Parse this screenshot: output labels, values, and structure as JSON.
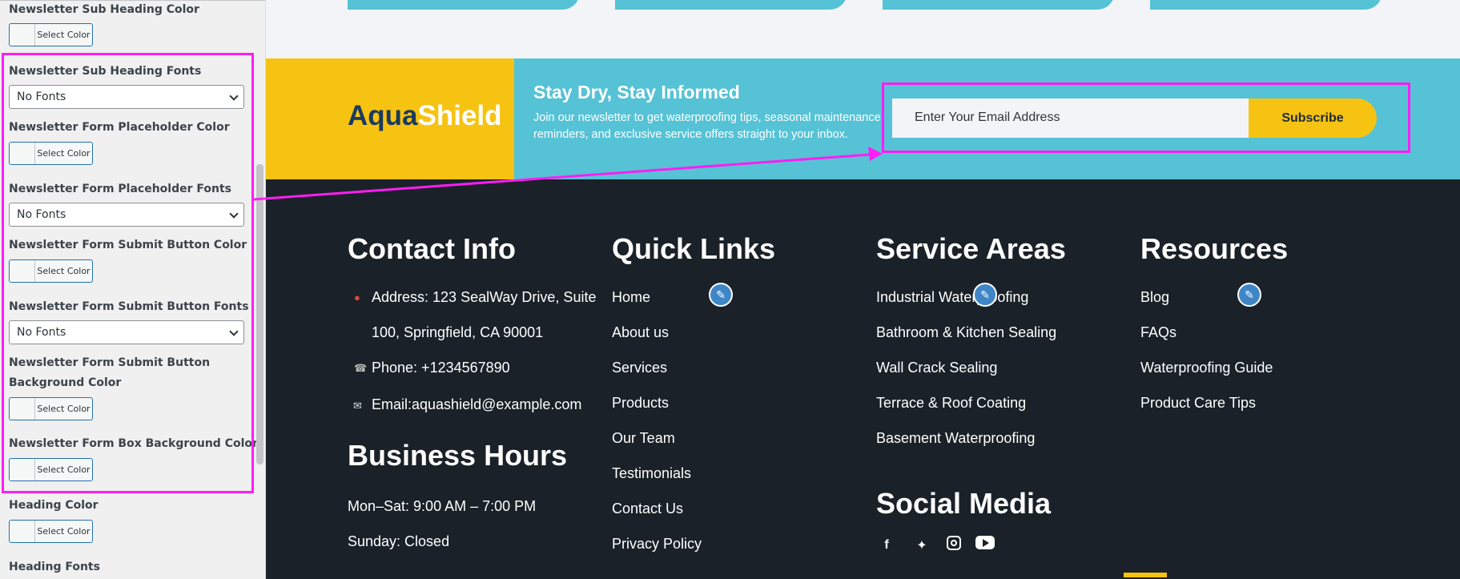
{
  "sidebar": {
    "fields": [
      {
        "label": "Newsletter Sub Heading Color",
        "type": "color",
        "button": "Select Color"
      },
      {
        "label": "Newsletter Sub Heading Fonts",
        "type": "select",
        "value": "No Fonts"
      },
      {
        "label": "Newsletter Form Placeholder Color",
        "type": "color",
        "button": "Select Color"
      },
      {
        "label": "Newsletter Form Placeholder Fonts",
        "type": "select",
        "value": "No Fonts"
      },
      {
        "label": "Newsletter Form Submit Button Color",
        "type": "color",
        "button": "Select Color"
      },
      {
        "label": "Newsletter Form Submit Button Fonts",
        "type": "select",
        "value": "No Fonts"
      },
      {
        "label": "Newsletter Form Submit Button Background Color",
        "type": "color",
        "button": "Select Color"
      },
      {
        "label": "Newsletter Form Box Background Color",
        "type": "color",
        "button": "Select Color"
      },
      {
        "label": "Heading Color",
        "type": "color",
        "button": "Select Color"
      },
      {
        "label": "Heading Fonts",
        "type": "select",
        "value": ""
      }
    ]
  },
  "newsletter": {
    "logo_part1": "Aqua",
    "logo_part2": "Shield",
    "title": "Stay Dry, Stay Informed",
    "description": "Join our newsletter to get waterproofing tips, seasonal maintenance reminders, and exclusive service offers straight to your inbox.",
    "email_placeholder": "Enter Your Email Address",
    "subscribe_label": "Subscribe"
  },
  "footer": {
    "contact": {
      "heading": "Contact Info",
      "address_line1": "Address: 123 SealWay Drive, Suite",
      "address_line2": "100, Springfield, CA 90001",
      "phone": "Phone: +1234567890",
      "email": "Email:aquashield@example.com"
    },
    "hours": {
      "heading": "Business Hours",
      "weekdays": "Mon–Sat: 9:00 AM – 7:00 PM",
      "sunday": "Sunday: Closed"
    },
    "quick_links": {
      "heading": "Quick Links",
      "items": [
        "Home",
        "About us",
        "Services",
        "Products",
        "Our Team",
        "Testimonials",
        "Contact Us",
        "Privacy Policy"
      ]
    },
    "service_areas": {
      "heading": "Service Areas",
      "items": [
        "Industrial Waterproofing",
        "Bathroom & Kitchen Sealing",
        "Wall Crack Sealing",
        "Terrace & Roof Coating",
        "Basement Waterproofing"
      ]
    },
    "resources": {
      "heading": "Resources",
      "items": [
        "Blog",
        "FAQs",
        "Waterproofing Guide",
        "Product Care Tips"
      ]
    },
    "social": {
      "heading": "Social Media",
      "icons": [
        "facebook-icon",
        "twitter-icon",
        "instagram-icon",
        "youtube-icon"
      ]
    }
  },
  "colors": {
    "accent_yellow": "#f6c312",
    "accent_teal": "#56c2d6",
    "footer_bg": "#1a2128",
    "highlight": "#ff1df3",
    "edit_blue": "#3f86c6"
  }
}
